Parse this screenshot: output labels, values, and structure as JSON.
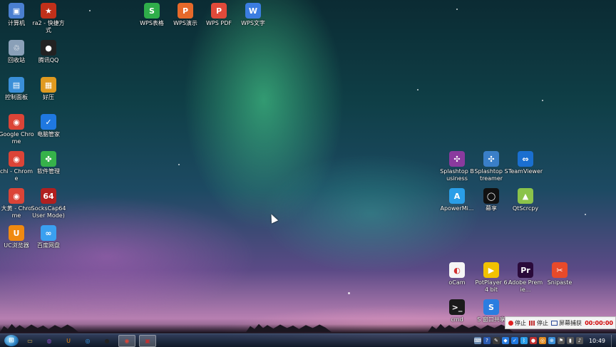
{
  "desktop_icons": [
    {
      "label": "计算机",
      "icon": "computer-icon",
      "color": "#4a7fd0",
      "glyph": "▣"
    },
    {
      "label": "ra2 - 快捷方式",
      "icon": "red-star-icon",
      "color": "#c0301a",
      "glyph": "★"
    },
    {
      "label": "回收站",
      "icon": "recycle-bin-icon",
      "color": "#8aa0b8",
      "glyph": "♲"
    },
    {
      "label": "腾讯QQ",
      "icon": "qq-penguin-icon",
      "color": "#222222",
      "glyph": "●"
    },
    {
      "label": "控制面板",
      "icon": "control-panel-icon",
      "color": "#3a8fd8",
      "glyph": "▤"
    },
    {
      "label": "好压",
      "icon": "haozip-icon",
      "color": "#e09a20",
      "glyph": "▦"
    },
    {
      "label": "Google Chrome",
      "icon": "chrome-icon",
      "color": "#db4437",
      "glyph": "◉"
    },
    {
      "label": "电脑管家",
      "icon": "shield-icon",
      "color": "#1f78e0",
      "glyph": "✓"
    },
    {
      "label": "chi - Chrome",
      "icon": "chrome-icon",
      "color": "#db4437",
      "glyph": "◉"
    },
    {
      "label": "软件管理",
      "icon": "clover-icon",
      "color": "#36b24a",
      "glyph": "✤"
    },
    {
      "label": "大黄 - Chrome",
      "icon": "chrome-icon",
      "color": "#db4437",
      "glyph": "◉"
    },
    {
      "label": "SocksCap64 User Mode)",
      "icon": "sockscap-icon",
      "color": "#b02020",
      "glyph": "64"
    },
    {
      "label": "UC浏览器",
      "icon": "uc-browser-icon",
      "color": "#f08a10",
      "glyph": "U"
    },
    {
      "label": "百度网盘",
      "icon": "baidu-netdisk-icon",
      "color": "#3aa0f0",
      "glyph": "∞"
    },
    {
      "label": "WPS表格",
      "icon": "wps-sheet-icon",
      "color": "#2fae4a",
      "glyph": "S"
    },
    {
      "label": "WPS演示",
      "icon": "wps-slides-icon",
      "color": "#e6692a",
      "glyph": "P"
    },
    {
      "label": "WPS PDF",
      "icon": "wps-pdf-icon",
      "color": "#e04a3a",
      "glyph": "P"
    },
    {
      "label": "WPS文字",
      "icon": "wps-writer-icon",
      "color": "#3b7de0",
      "glyph": "W"
    },
    {
      "label": "Splashtop Business",
      "icon": "splashtop-business-icon",
      "color": "#8a3a9e",
      "glyph": "✣"
    },
    {
      "label": "Splashtop Streamer",
      "icon": "splashtop-streamer-icon",
      "color": "#3a7fc8",
      "glyph": "✣"
    },
    {
      "label": "TeamViewer",
      "icon": "teamviewer-icon",
      "color": "#1a6fd0",
      "glyph": "⇔"
    },
    {
      "label": "ApowerMi...",
      "icon": "apowermirror-icon",
      "color": "#2a9ee8",
      "glyph": "A"
    },
    {
      "label": "幕享",
      "icon": "muxiang-icon",
      "color": "#111111",
      "glyph": "◯"
    },
    {
      "label": "QtScrcpy",
      "icon": "android-icon",
      "color": "#8bc34a",
      "glyph": "▲"
    },
    {
      "label": "oCam",
      "icon": "ocam-icon",
      "color": "#f5f5f5",
      "glyph": "◐"
    },
    {
      "label": "PotPlayer 64 bit",
      "icon": "potplayer-icon",
      "color": "#f2c200",
      "glyph": "▶"
    },
    {
      "label": "Adobe Premie...",
      "icon": "premiere-icon",
      "color": "#2a0a3a",
      "glyph": "Pr"
    },
    {
      "label": "Snipaste",
      "icon": "snipaste-icon",
      "color": "#e84a2a",
      "glyph": "✂"
    },
    {
      "label": "cmd",
      "icon": "terminal-icon",
      "color": "#1a1a1a",
      "glyph": ">_"
    },
    {
      "label": "S 窗口共享",
      "icon": "window-share-icon",
      "color": "#2a7de0",
      "glyph": "S"
    }
  ],
  "recorder": {
    "stop1": "停止",
    "stop2": "停止",
    "capture": "屏幕捕获",
    "timer": "00:00:00"
  },
  "taskbar": {
    "start_glyph": "⊞",
    "clock": "10:49",
    "apps": [
      {
        "icon": "folder-icon",
        "glyph": "▭",
        "color": "#d8b04a",
        "active": false
      },
      {
        "icon": "media-icon",
        "glyph": "◍",
        "color": "#8a4fc0",
        "active": false
      },
      {
        "icon": "uc-icon",
        "glyph": "U",
        "color": "#f08a10",
        "active": false
      },
      {
        "icon": "browser-icon",
        "glyph": "◎",
        "color": "#3aa0f0",
        "active": false
      },
      {
        "icon": "qq-icon",
        "glyph": "●",
        "color": "#222222",
        "active": false
      },
      {
        "icon": "chrome-icon",
        "glyph": "◉",
        "color": "#db4437",
        "active": true
      },
      {
        "icon": "recorder-icon",
        "glyph": "▣",
        "color": "#c03030",
        "active": true
      }
    ]
  }
}
